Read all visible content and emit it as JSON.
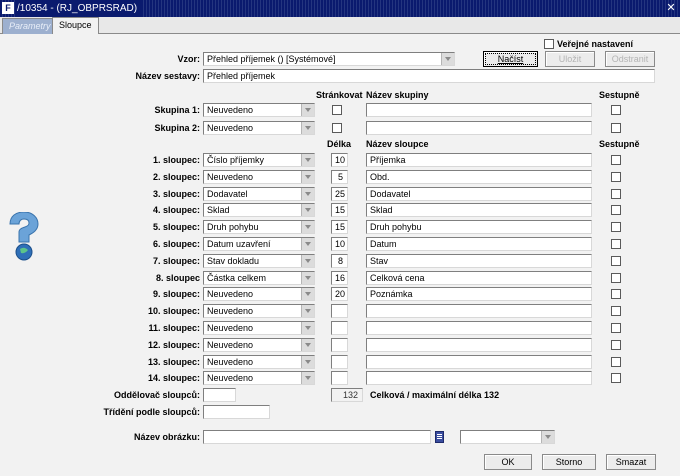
{
  "window": {
    "title": "/10354 - (RJ_OBPRSRAD)",
    "logo_text": "F"
  },
  "tabs": [
    {
      "label": "Parametry"
    },
    {
      "label": "Sloupce"
    }
  ],
  "form": {
    "vzor_label": "Vzor:",
    "vzor_value": "Přehled příjemek  ()  [Systémové]",
    "verejne_label": "Veřejné nastavení",
    "nacist_label": "Načíst",
    "ulozit_label": "Uložit",
    "odstranit_label": "Odstranit",
    "nazev_sestavy_label": "Název sestavy:",
    "nazev_sestavy_value": "Přehled příjemek",
    "hdr_strankovat": "Stránkovat",
    "hdr_nazev_skupiny": "Název skupiny",
    "hdr_sestupne": "Sestupně",
    "hdr_delka": "Délka",
    "hdr_nazev_sloupce": "Název sloupce",
    "hdr_sestupne2": "Sestupně",
    "groups": [
      {
        "label": "Skupina 1:",
        "value": "Neuvedeno",
        "name": ""
      },
      {
        "label": "Skupina 2:",
        "value": "Neuvedeno",
        "name": ""
      }
    ],
    "columns": [
      {
        "label": "1. sloupec:",
        "value": "Číslo příjemky",
        "length": "10",
        "name": "Příjemka"
      },
      {
        "label": "2. sloupec:",
        "value": "Neuvedeno",
        "length": "5",
        "name": "Obd."
      },
      {
        "label": "3. sloupec:",
        "value": "Dodavatel",
        "length": "25",
        "name": "Dodavatel"
      },
      {
        "label": "4. sloupec:",
        "value": "Sklad",
        "length": "15",
        "name": "Sklad"
      },
      {
        "label": "5. sloupec:",
        "value": "Druh pohybu",
        "length": "15",
        "name": "Druh pohybu"
      },
      {
        "label": "6. sloupec:",
        "value": "Datum uzavření",
        "length": "10",
        "name": "Datum"
      },
      {
        "label": "7. sloupec:",
        "value": "Stav dokladu",
        "length": "8",
        "name": "Stav"
      },
      {
        "label": "8. sloupec",
        "value": "Částka celkem",
        "length": "16",
        "name": "Celková cena"
      },
      {
        "label": "9. sloupec:",
        "value": "Neuvedeno",
        "length": "20",
        "name": "Poznámka"
      },
      {
        "label": "10. sloupec:",
        "value": "Neuvedeno",
        "length": "",
        "name": ""
      },
      {
        "label": "11. sloupec:",
        "value": "Neuvedeno",
        "length": "",
        "name": ""
      },
      {
        "label": "12. sloupec:",
        "value": "Neuvedeno",
        "length": "",
        "name": ""
      },
      {
        "label": "13. sloupec:",
        "value": "Neuvedeno",
        "length": "",
        "name": ""
      },
      {
        "label": "14. sloupec:",
        "value": "Neuvedeno",
        "length": "",
        "name": ""
      }
    ],
    "oddelovac_label": "Oddělovač sloupců:",
    "oddelovac_value": "",
    "celkova_value": "132",
    "celkova_label": "Celková / maximální délka 132",
    "trideni_label": "Třídění podle sloupců:",
    "trideni_value": "",
    "nazev_obrazku_label": "Název obrázku:",
    "nazev_obrazku_value": "",
    "obrazek_select_value": ""
  },
  "footer": {
    "ok_label": "OK",
    "storno_label": "Storno",
    "smazat_label": "Smazat"
  },
  "colors": {
    "titlebar": "#0a1a6e",
    "panel": "#f2f2f2",
    "tab_inactive": "#9db0cf"
  },
  "icons": {
    "help": "question-mark-icon",
    "list": "list-icon"
  }
}
